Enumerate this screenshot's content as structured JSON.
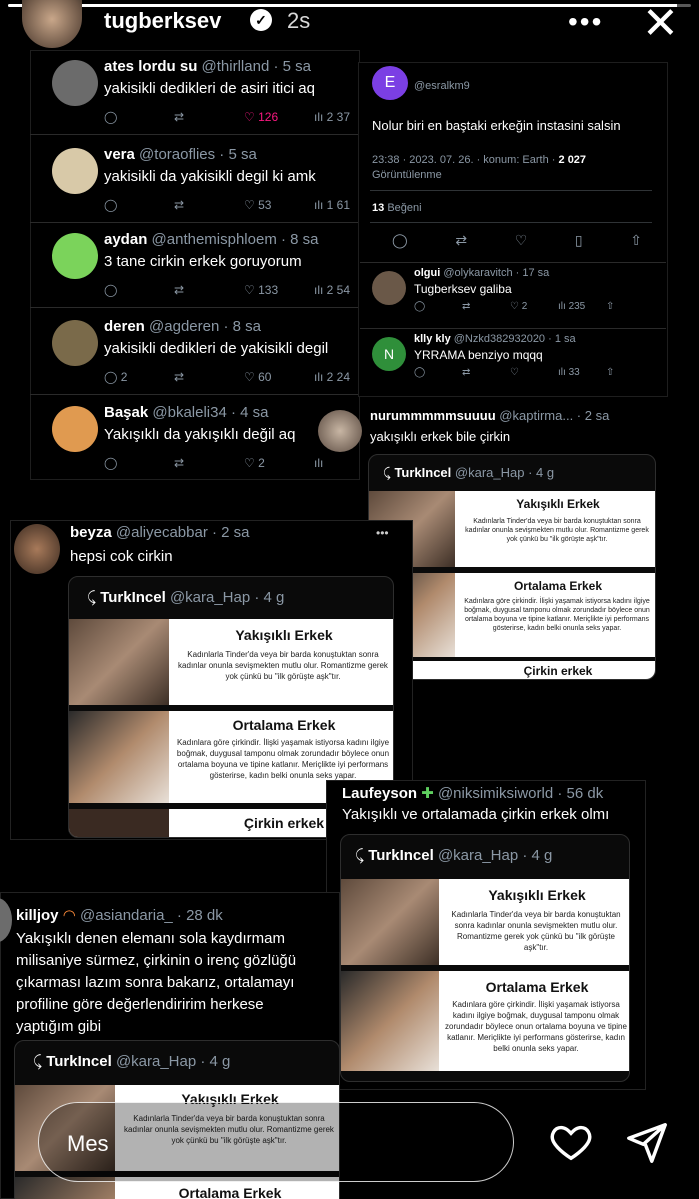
{
  "story": {
    "progress": 0.98,
    "user": "tugberksev",
    "time": "2s",
    "more": "•••",
    "close": "✕"
  },
  "topTweets": [
    {
      "name": "ates lordu su",
      "handle": "@thirlland · 5 sa",
      "text": "yakisikli dedikleri de asiri itici aq",
      "actions": [
        "",
        "",
        "126",
        "2 37"
      ],
      "avatar": "#6b6b6b"
    },
    {
      "name": "vera",
      "handle": "@toraoflies · 5 sa",
      "text": "yakisikli da yakisikli degil ki amk",
      "actions": [
        "",
        "",
        "53",
        "1 61"
      ],
      "avatar": "#d8c9a8"
    },
    {
      "name": "aydan",
      "handle": "@anthemisphloem · 8 sa",
      "text": "3 tane cirkin erkek goruyorum",
      "actions": [
        "",
        "",
        "133",
        "2 54"
      ],
      "avatar": "#7bd35b"
    },
    {
      "name": "deren",
      "handle": "@agderen · 8 sa",
      "text": "yakisikli dedikleri de yakisikli degil",
      "actions": [
        "2",
        "",
        "60",
        "2 24"
      ],
      "avatar": "#7a6a4a"
    },
    {
      "name": "Başak",
      "handle": "@bkaleli34 · 4 sa",
      "text": "Yakışıklı da yakışıklı değil aq",
      "actions": [
        "",
        "",
        "2",
        ""
      ],
      "avatar": "#e09a50"
    }
  ],
  "rightTweet": {
    "avatarLetter": "E",
    "handle": "@esralkm9",
    "text": "Nolur biri en baştaki erkeğin instasini salsin",
    "meta": "23:38 · 2023. 07. 26. · konum: Earth ·",
    "views": "2 027",
    "viewsLabel": "Görüntülenme",
    "likes": "13",
    "likesLabel": "Beğeni",
    "replies": [
      {
        "name": "olgui",
        "handle": "@olykaravitch · 17 sa",
        "text": "Tugberksev galiba",
        "actions": [
          "",
          "",
          "2",
          "235"
        ]
      },
      {
        "name": "klly kly",
        "handle": "@Nzkd382932020 · 1 sa",
        "text": "YRRAMA benziyo mqqq",
        "actions": [
          "",
          "",
          "",
          "33"
        ]
      }
    ]
  },
  "nurum": {
    "name": "nurummmmmsuuuu",
    "handle": "@kaptirma... · 2 sa",
    "text": "yakışıklı erkek bile çirkin"
  },
  "beyza": {
    "name": "beyza",
    "handle": "@aliyecabbar · 2 sa",
    "text": "hepsi cok cirkin",
    "more": "•••"
  },
  "laufeyson": {
    "name": "Laufeyson",
    "handle": "@niksimiksiworld · 56 dk",
    "text": "Yakışıklı ve ortalamada çirkin erkek olmı"
  },
  "killjoy": {
    "name": "killjoy",
    "handle": "@asiandaria_ · 28 dk",
    "lines": [
      "Yakışıklı denen elemanı sola kaydırmam",
      "milisaniye sürmez, çirkinin o irenç gözlüğü",
      "çıkarması lazım sonra bakarız, ortalamayı",
      "profiline göre değerlendiririm herkese",
      "yaptığım gibi"
    ]
  },
  "quote": {
    "name": "TurkIncel",
    "handle": "@kara_Hap · 4 g",
    "s1": {
      "title": "Yakışıklı Erkek",
      "body": "Kadınlarla Tinder'da veya bir barda konuştuktan sonra kadınlar onunla sevişmekten mutlu olur. Romantizme gerek yok çünkü bu \"ilk görüşte aşk\"tır."
    },
    "s2": {
      "title": "Ortalama Erkek",
      "body": "Kadınlara göre çirkindir. İlişki yaşamak istiyorsa kadını ilgiye boğmak, duygusal tamponu olmak zorundadır böylece onun ortalama boyuna ve tipine katlanır. Meriçlikte iyi performans gösterirse, kadın belki onunla seks yapar."
    },
    "s3": {
      "title": "Çirkin erkek"
    }
  },
  "reply": {
    "placeholder": "Mes"
  }
}
